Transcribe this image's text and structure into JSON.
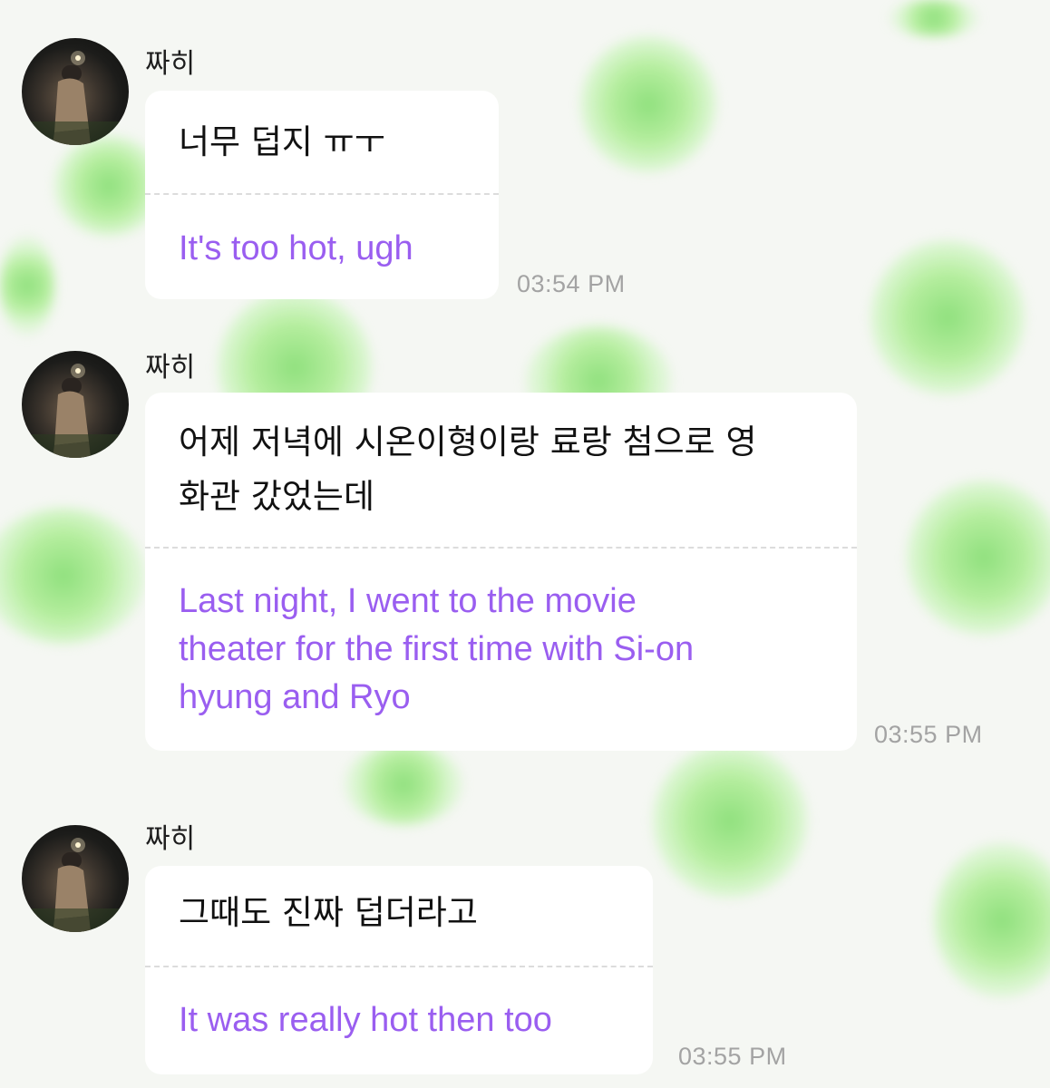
{
  "messages": [
    {
      "sender": "짜히",
      "original": "너무 덥지 ㅠㅜ",
      "translation": "It's too hot, ugh",
      "time": "03:54 PM"
    },
    {
      "sender": "짜히",
      "original_lines": [
        "어제 저녁에 시온이형이랑 료랑 첨으로 영",
        "화관 갔었는데"
      ],
      "translation_lines": [
        "Last night, I went to the movie",
        "theater for the first time with Si-on",
        "hyung and Ryo"
      ],
      "time": "03:55 PM"
    },
    {
      "sender": "짜히",
      "original": "그때도 진짜 덥더라고",
      "translation": "It was really hot then too",
      "time": "03:55 PM"
    }
  ],
  "colors": {
    "translation_text": "#9a5ef0",
    "bubble_bg": "#ffffff",
    "timestamp": "#a3a3a3",
    "background_accent": "#8fe07d"
  }
}
